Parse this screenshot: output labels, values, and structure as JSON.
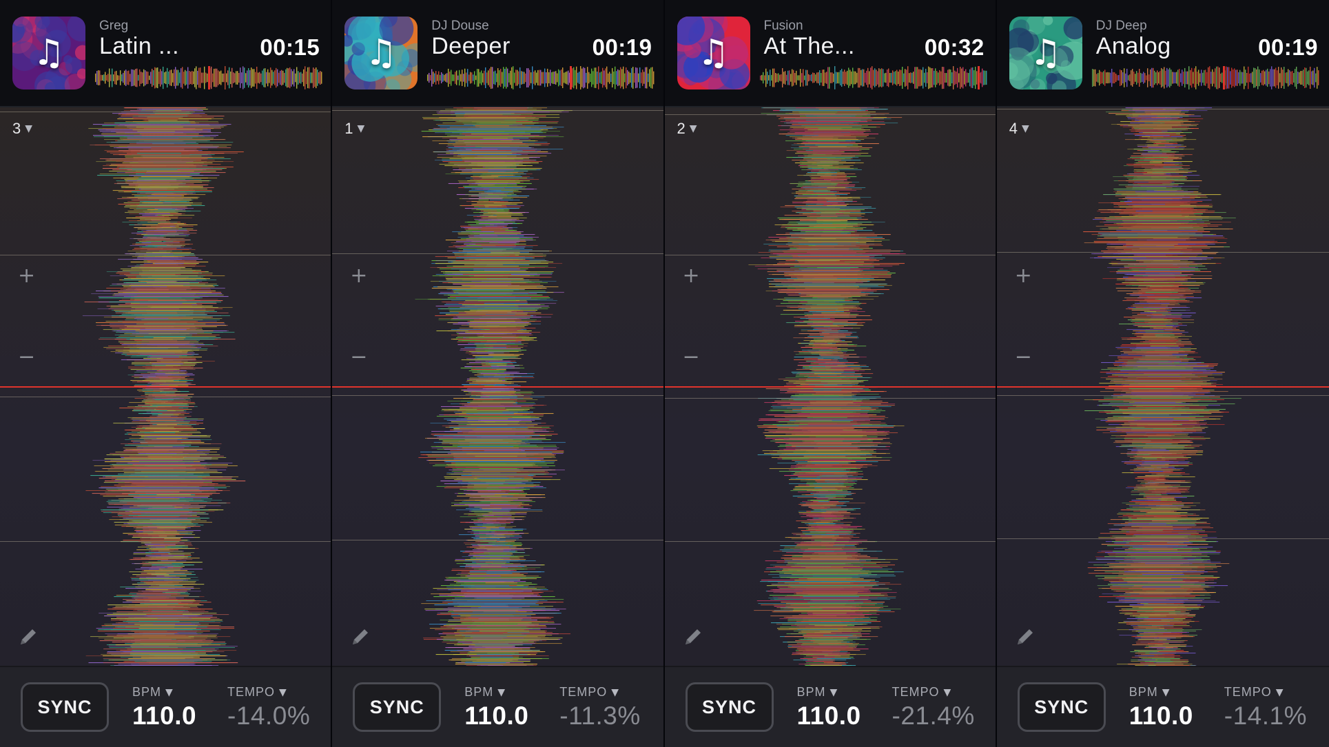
{
  "decks": [
    {
      "artist": "Greg",
      "title": "Latin ...",
      "time": "00:15",
      "deck_number": "3",
      "sync_label": "SYNC",
      "bpm_label": "BPM",
      "bpm_value": "110.0",
      "tempo_label": "TEMPO",
      "tempo_value": "-14.0%",
      "mini_progress": 0.5,
      "art_colors": [
        "#5a1a7a",
        "#d0306a",
        "#3a3aa0"
      ],
      "bg_color": "#2b2626",
      "wave_colors": [
        "#f0c040",
        "#e05a3a",
        "#40c0a0",
        "#a070e0",
        "#d0d050",
        "#f07060"
      ]
    },
    {
      "artist": "DJ Douse",
      "title": "Deeper",
      "time": "00:19",
      "deck_number": "1",
      "sync_label": "SYNC",
      "bpm_label": "BPM",
      "bpm_value": "110.0",
      "tempo_label": "TEMPO",
      "tempo_value": "-11.3%",
      "mini_progress": 0.63,
      "art_colors": [
        "#e0742a",
        "#3040a0",
        "#30b0c0"
      ],
      "bg_color": "#2a2628",
      "wave_colors": [
        "#d0d040",
        "#70d040",
        "#e05040",
        "#40a0e0",
        "#f0b040",
        "#c070e0"
      ]
    },
    {
      "artist": "Fusion",
      "title": "At The...",
      "time": "00:32",
      "deck_number": "2",
      "sync_label": "SYNC",
      "bpm_label": "BPM",
      "bpm_value": "110.0",
      "tempo_label": "TEMPO",
      "tempo_value": "-21.4%",
      "mini_progress": 0.96,
      "art_colors": [
        "#e0243a",
        "#2a40c0",
        "#c02a70"
      ],
      "bg_color": "#2a2628",
      "wave_colors": [
        "#f06040",
        "#e0c040",
        "#40b0c0",
        "#70d050",
        "#f08050",
        "#e04070"
      ]
    },
    {
      "artist": "DJ Deep",
      "title": "Analog",
      "time": "00:19",
      "deck_number": "4",
      "sync_label": "SYNC",
      "bpm_label": "BPM",
      "bpm_value": "110.0",
      "tempo_label": "TEMPO",
      "tempo_value": "-14.1%",
      "mini_progress": 0.58,
      "art_colors": [
        "#2a9a80",
        "#20406a",
        "#60c0a0"
      ],
      "bg_color": "#2a2628",
      "wave_colors": [
        "#f06040",
        "#e03a30",
        "#d0c040",
        "#8060e0",
        "#70c060",
        "#f09050"
      ]
    }
  ],
  "colors": {
    "playhead": "#e0342c",
    "header_bg": "#0d0e12",
    "footer_bg": "#232329",
    "beatline": "#b4aa96"
  },
  "icons": {
    "deck_menu": "chevron-down-icon",
    "zoom_in": "plus-icon",
    "zoom_out": "minus-icon",
    "edit": "pencil-icon",
    "art": "music-note-icon"
  }
}
